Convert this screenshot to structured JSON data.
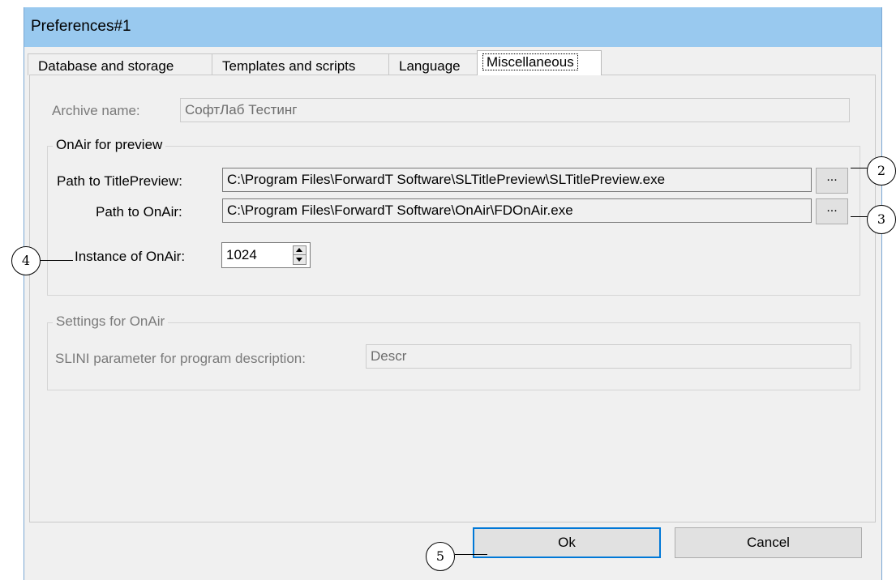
{
  "window": {
    "title": "Preferences#1"
  },
  "tabs": [
    {
      "label": "Database and storage"
    },
    {
      "label": "Templates and scripts"
    },
    {
      "label": "Language"
    },
    {
      "label": "Miscellaneous",
      "active": true
    }
  ],
  "archive": {
    "label": "Archive name:",
    "value": "СофтЛаб Тестинг"
  },
  "onair_preview": {
    "legend": "OnAir for preview",
    "title_preview_label": "Path to TitlePreview:",
    "title_preview_value": "C:\\Program Files\\ForwardT Software\\SLTitlePreview\\SLTitlePreview.exe",
    "onair_label": "Path to OnAir:",
    "onair_value": "C:\\Program Files\\ForwardT Software\\OnAir\\FDOnAir.exe",
    "browse_label": "...",
    "instance_label": "Instance of OnAir:",
    "instance_value": "1024"
  },
  "settings_onair": {
    "legend": "Settings for OnAir",
    "slini_label": "SLINI parameter for program description:",
    "slini_value": "Descr"
  },
  "buttons": {
    "ok": "Ok",
    "cancel": "Cancel"
  },
  "callouts": {
    "c2": "2",
    "c3": "3",
    "c4": "4",
    "c5": "5"
  }
}
